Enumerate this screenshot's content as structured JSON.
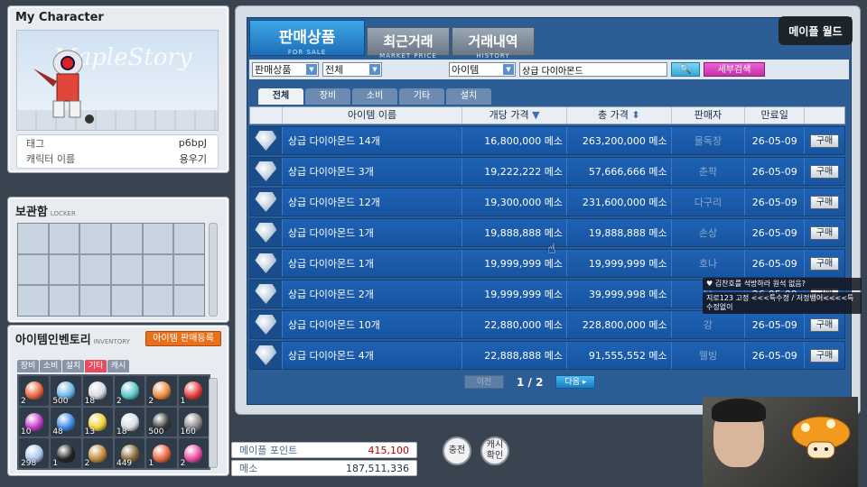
{
  "character": {
    "title": "My Character",
    "watermark": "MapleStory",
    "info": [
      {
        "label": "태그",
        "value": "p6bpJ"
      },
      {
        "label": "캐릭터 이름",
        "value": "용우기"
      }
    ]
  },
  "locker": {
    "title": "보관함",
    "subtitle": "LOCKER"
  },
  "inventory": {
    "title": "아이템인벤토리",
    "subtitle": "INVENTORY",
    "register_label": "아이템 판매등록",
    "tabs": [
      "장비",
      "소비",
      "설치",
      "기타",
      "캐시"
    ],
    "active_tab": 3,
    "slots": [
      {
        "count": "2",
        "color": "#e8643c"
      },
      {
        "count": "500",
        "color": "#6cb8e8"
      },
      {
        "count": "18",
        "color": "#d8d8e0"
      },
      {
        "count": "2",
        "color": "#58c9c9"
      },
      {
        "count": "2",
        "color": "#f08a3c"
      },
      {
        "count": "1",
        "color": "#e83a3a"
      },
      {
        "count": "10",
        "color": "#c23ac9"
      },
      {
        "count": "48",
        "color": "#3a8ae8"
      },
      {
        "count": "13",
        "color": "#f0d23c"
      },
      {
        "count": "18",
        "color": "#d8dce4"
      },
      {
        "count": "500",
        "color": "#3a3a3a"
      },
      {
        "count": "160",
        "color": "#8a8a8a"
      },
      {
        "count": "298",
        "color": "#a8c8f0"
      },
      {
        "count": "1",
        "color": "#222222"
      },
      {
        "count": "2",
        "color": "#c08a3c"
      },
      {
        "count": "449",
        "color": "#8a6a3c"
      },
      {
        "count": "1",
        "color": "#e8643c"
      },
      {
        "count": "2",
        "color": "#e84aa0"
      }
    ]
  },
  "points": {
    "maple_label": "메이플 포인트",
    "maple_value": "415,100",
    "meso_label": "메소",
    "meso_value": "187,511,336"
  },
  "round_buttons": {
    "charge": "충전",
    "cash": "캐시\n확인"
  },
  "main": {
    "tabs": [
      {
        "label": "판매상품",
        "sub": "FOR SALE"
      },
      {
        "label": "최근거래",
        "sub": "MARKET PRICE"
      },
      {
        "label": "거래내역",
        "sub": "HISTORY"
      }
    ],
    "filters": {
      "cat1": "판매상품",
      "cat2": "전체",
      "field": "아이템",
      "query": "상급 다이아몬드",
      "search": "🔍",
      "detail": "세부검색"
    },
    "category_tabs": [
      "전체",
      "장비",
      "소비",
      "기타",
      "설치"
    ],
    "active_category": 0,
    "columns": {
      "name": "아이템 이름",
      "unit": "개당 가격",
      "total": "총 가격",
      "seller": "판매자",
      "expiry": "만료일"
    },
    "buy_label": "구매",
    "rows": [
      {
        "name": "상급 다이아몬드 14개",
        "unit": "16,800,000 메소",
        "total": "263,200,000 메소",
        "seller": "물독장",
        "expiry": "26-05-09"
      },
      {
        "name": "상급 다이아몬드 3개",
        "unit": "19,222,222 메소",
        "total": "57,666,666 메소",
        "seller": "춘팍",
        "expiry": "26-05-09"
      },
      {
        "name": "상급 다이아몬드 12개",
        "unit": "19,300,000 메소",
        "total": "231,600,000 메소",
        "seller": "다구리",
        "expiry": "26-05-09"
      },
      {
        "name": "상급 다이아몬드 1개",
        "unit": "19,888,888 메소",
        "total": "19,888,888 메소",
        "seller": "손상",
        "expiry": "26-05-09"
      },
      {
        "name": "상급 다이아몬드 1개",
        "unit": "19,999,999 메소",
        "total": "19,999,999 메소",
        "seller": "호나",
        "expiry": "26-05-09"
      },
      {
        "name": "상급 다이아몬드 2개",
        "unit": "19,999,999 메소",
        "total": "39,999,998 메소",
        "seller": "탁",
        "expiry": "26-05-09"
      },
      {
        "name": "상급 다이아몬드 10개",
        "unit": "22,880,000 메소",
        "total": "228,800,000 메소",
        "seller": "강",
        "expiry": "26-05-09"
      },
      {
        "name": "상급 다이아몬드 4개",
        "unit": "22,888,888 메소",
        "total": "91,555,552 메소",
        "seller": "웰빙",
        "expiry": "26-05-09"
      }
    ],
    "pager": {
      "prev": "이전",
      "page": "1 / 2",
      "next": "다음 ▸"
    }
  },
  "stream": {
    "logo": "메이플 월드",
    "chat": [
      {
        "text": "♥ 김찬호를 석방하라 원석 없음?"
      },
      {
        "text": "지로123 고정 <<<특수정 / 저정뱅어<<<<특 수정없이"
      }
    ]
  }
}
